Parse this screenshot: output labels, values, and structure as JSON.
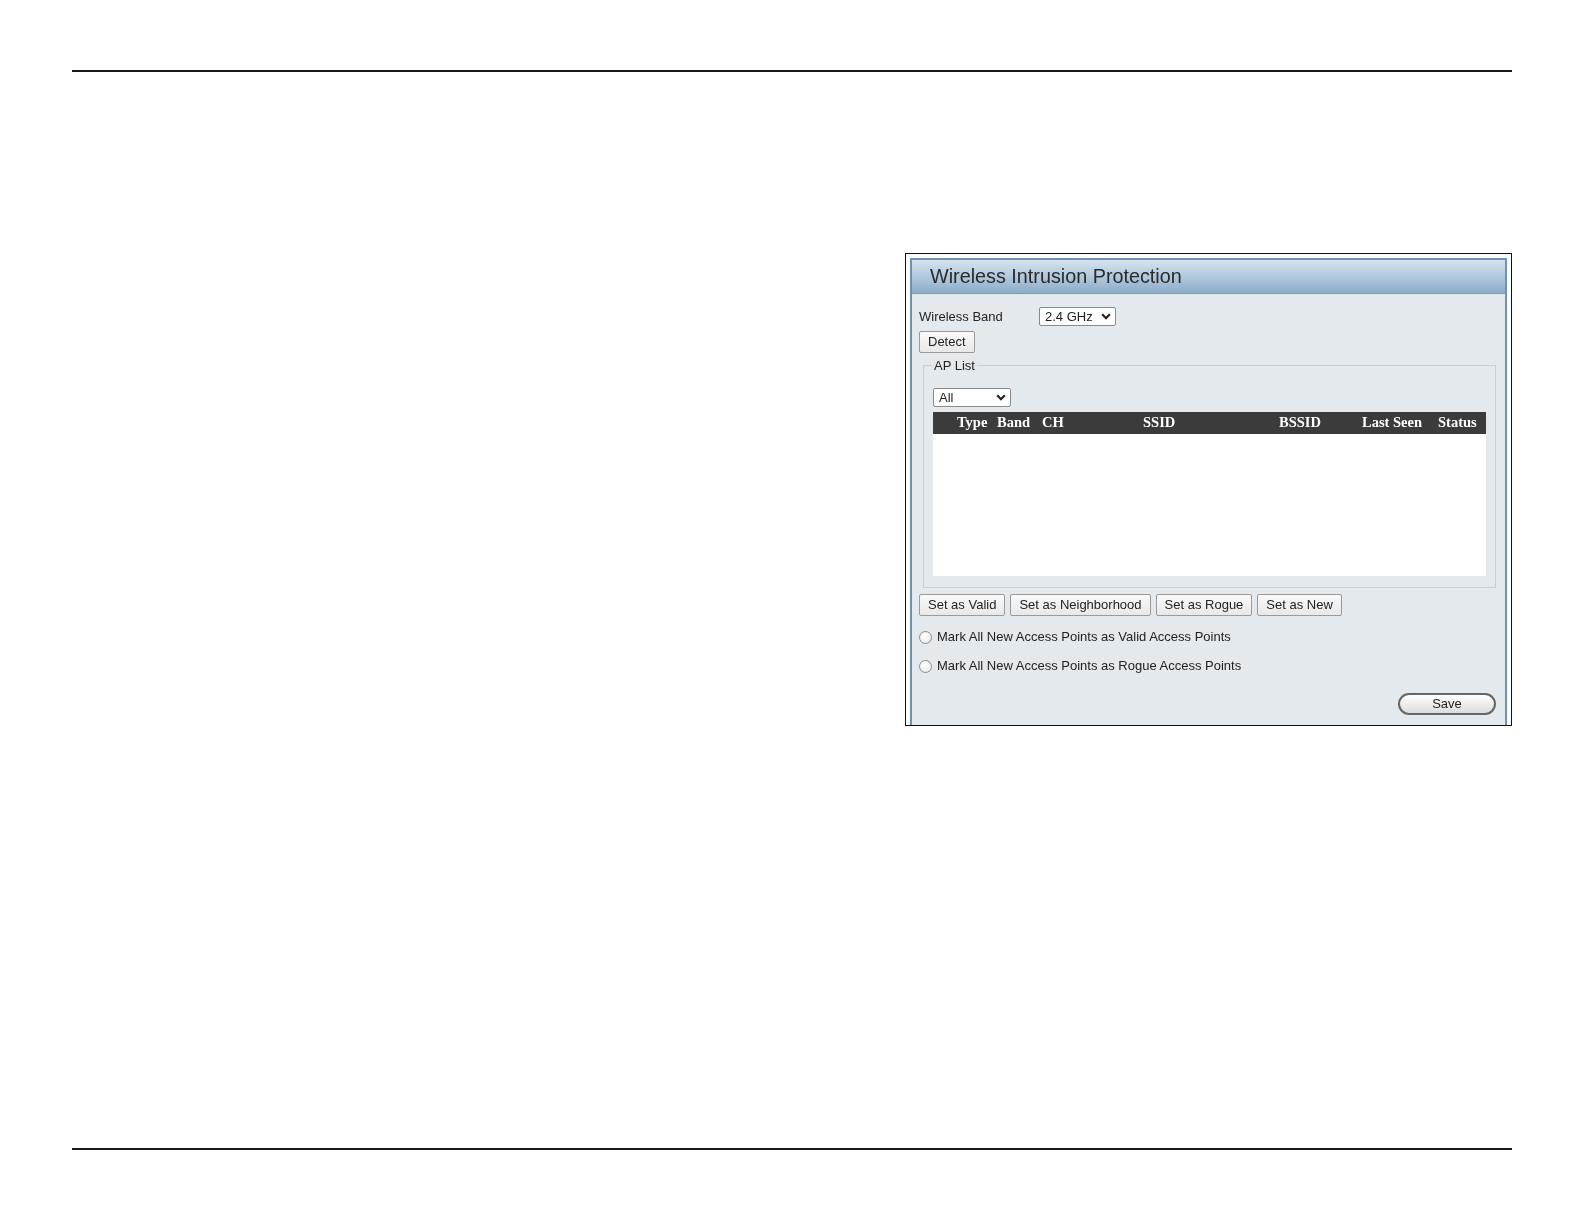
{
  "panel": {
    "title": "Wireless Intrusion Protection",
    "wireless_band": {
      "label": "Wireless Band",
      "value": "2.4 GHz"
    },
    "detect_button": "Detect",
    "ap_list": {
      "legend": "AP List",
      "filter": {
        "value": "All"
      },
      "table": {
        "columns": [
          "Type",
          "Band",
          "CH",
          "SSID",
          "BSSID",
          "Last Seen",
          "Status"
        ]
      }
    },
    "buttons": [
      "Set as Valid",
      "Set as Neighborhood",
      "Set as Rogue",
      "Set as New"
    ],
    "options": [
      {
        "label": "Mark All New Access Points as Valid Access Points",
        "selected": false
      },
      {
        "label": "Mark All New Access Points as Rogue Access Points",
        "selected": false
      }
    ],
    "save_button": "Save"
  }
}
